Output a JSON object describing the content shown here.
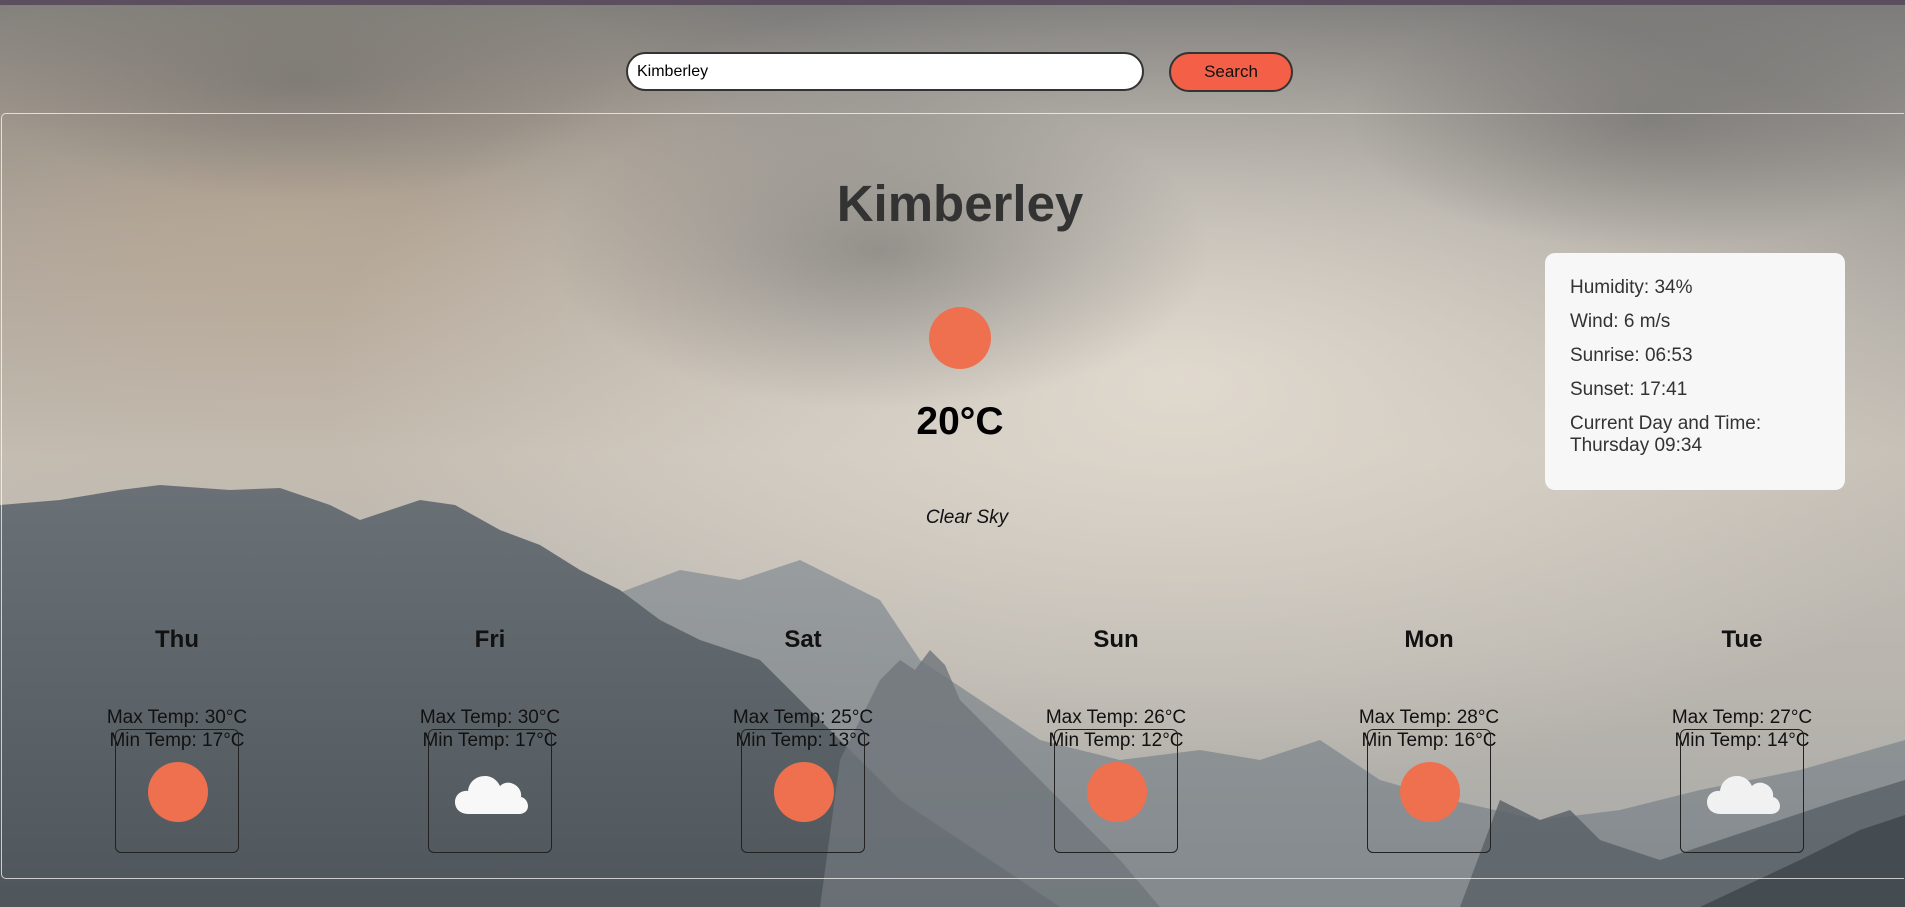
{
  "search": {
    "value": "Kimberley",
    "button_label": "Search"
  },
  "current": {
    "city": "Kimberley",
    "icon": "sun-icon",
    "temperature": "20°C",
    "description": "Clear Sky"
  },
  "details": {
    "humidity": "Humidity: 34%",
    "wind": "Wind: 6 m/s",
    "sunrise": "Sunrise: 06:53",
    "sunset": "Sunset: 17:41",
    "datetime_label": "Current Day and Time:",
    "datetime_value": "Thursday 09:34"
  },
  "forecast": [
    {
      "day": "Thu",
      "max": "Max Temp: 30°C",
      "min": "Min Temp: 17°C",
      "icon": "sun-icon"
    },
    {
      "day": "Fri",
      "max": "Max Temp: 30°C",
      "min": "Min Temp: 17°C",
      "icon": "cloud-icon"
    },
    {
      "day": "Sat",
      "max": "Max Temp: 25°C",
      "min": "Min Temp: 13°C",
      "icon": "sun-icon"
    },
    {
      "day": "Sun",
      "max": "Max Temp: 26°C",
      "min": "Min Temp: 12°C",
      "icon": "sun-icon"
    },
    {
      "day": "Mon",
      "max": "Max Temp: 28°C",
      "min": "Min Temp: 16°C",
      "icon": "sun-icon"
    },
    {
      "day": "Tue",
      "max": "Max Temp: 27°C",
      "min": "Min Temp: 14°C",
      "icon": "cloud-icon"
    }
  ],
  "colors": {
    "accent": "#f36047",
    "sun": "#ee704e",
    "card_bg": "#f7f7f7",
    "title": "#333333"
  }
}
